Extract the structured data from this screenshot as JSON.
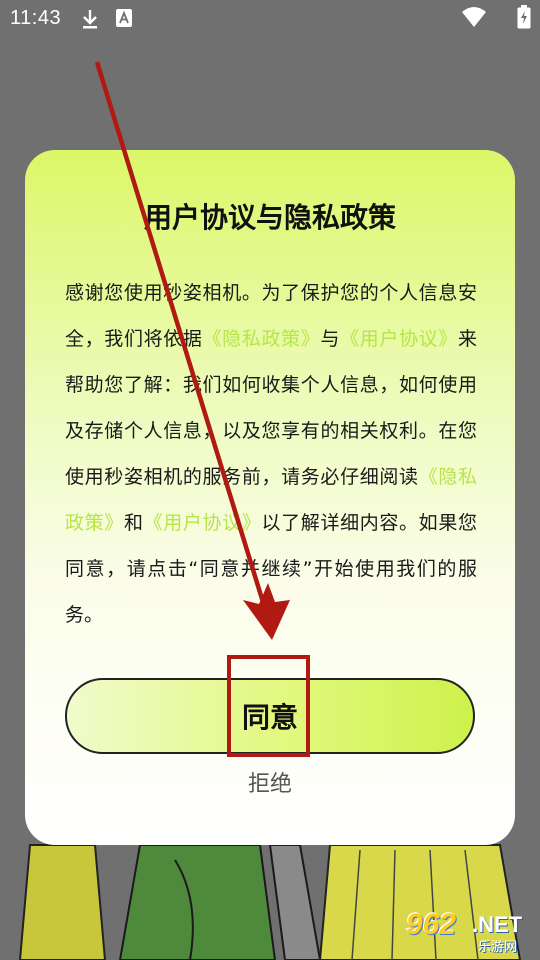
{
  "status_bar": {
    "time": "11:43",
    "icons": [
      "download-icon",
      "text-a-icon",
      "wifi-icon",
      "battery-icon"
    ]
  },
  "dialog": {
    "title": "用户协议与隐私政策",
    "body": [
      {
        "text": "感谢您使用秒姿相机。为了保护您的个人信息安全，我们将依据",
        "link": false
      },
      {
        "text": "《隐私政策》",
        "link": true
      },
      {
        "text": "与",
        "link": false
      },
      {
        "text": "《用户协议》",
        "link": true
      },
      {
        "text": "来帮助您了解：我们如何收集个人信息，如何使用及存储个人信息，以及您享有的相关权利。在您使用秒姿相机的服务前，请务必仔细阅读",
        "link": false
      },
      {
        "text": "《隐私政策》",
        "link": true
      },
      {
        "text": "和",
        "link": false
      },
      {
        "text": "《用户协议》",
        "link": true
      },
      {
        "text": "以了解详细内容。如果您同意，请点击“同意并继续”开始使用我们的服务。",
        "link": false
      }
    ],
    "agree_label": "同意",
    "reject_label": "拒绝"
  },
  "watermark": {
    "number": "962",
    "suffix": ".NET",
    "chinese": "乐游网"
  },
  "colors": {
    "link": "#b7e548",
    "annotation": "#b11a12",
    "dialog_top": "#dcf768"
  }
}
